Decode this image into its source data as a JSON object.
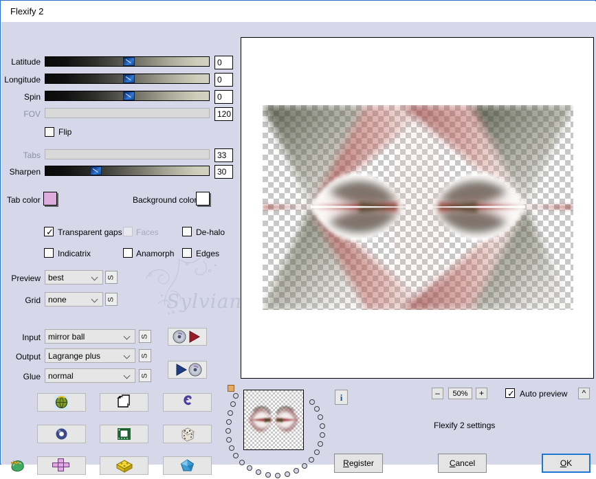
{
  "window": {
    "title": "Flexify 2"
  },
  "sliders": [
    {
      "label": "Latitude",
      "value": "0",
      "pct": 50,
      "disabled": false
    },
    {
      "label": "Longitude",
      "value": "0",
      "pct": 50,
      "disabled": false
    },
    {
      "label": "Spin",
      "value": "0",
      "pct": 50,
      "disabled": false
    },
    {
      "label": "FOV",
      "value": "120",
      "pct": 0,
      "disabled": true
    },
    {
      "label": "Tabs",
      "value": "33",
      "pct": 0,
      "disabled": true
    },
    {
      "label": "Sharpen",
      "value": "30",
      "pct": 30,
      "disabled": false
    }
  ],
  "flip": {
    "label": "Flip",
    "checked": false
  },
  "colors": {
    "tab_label": "Tab color",
    "tab_value": "#dcacdc",
    "background_label": "Background color",
    "background_value": "#ffffff"
  },
  "options": [
    {
      "label": "Transparent gaps",
      "checked": true,
      "disabled": false
    },
    {
      "label": "Faces",
      "checked": false,
      "disabled": true
    },
    {
      "label": "De-halo",
      "checked": false,
      "disabled": false
    },
    {
      "label": "Indicatrix",
      "checked": false,
      "disabled": false
    },
    {
      "label": "Anamorph",
      "checked": false,
      "disabled": false
    },
    {
      "label": "Edges",
      "checked": false,
      "disabled": false
    }
  ],
  "selects": [
    {
      "label": "Preview",
      "value": "best",
      "side_button": "S"
    },
    {
      "label": "Grid",
      "value": "none",
      "side_button": "S"
    },
    {
      "label": "Input",
      "value": "mirror ball",
      "side_button": "S"
    },
    {
      "label": "Output",
      "value": "Lagrange plus",
      "side_button": "S"
    },
    {
      "label": "Glue",
      "value": "normal",
      "side_button": "S"
    }
  ],
  "media_buttons": [
    {
      "name": "load-settings-button",
      "icons": "disc-icon, play-right-icon"
    },
    {
      "name": "save-settings-button",
      "icons": "play-right-icon, disc-icon"
    }
  ],
  "grid_buttons": [
    {
      "name": "globe-button",
      "icon": "globe-icon"
    },
    {
      "name": "pages-button",
      "icon": "pages-icon"
    },
    {
      "name": "undo-button",
      "icon": "undo-arrow-icon"
    },
    {
      "name": "sphere-button",
      "icon": "ring-icon"
    },
    {
      "name": "chip-button",
      "icon": "chip-icon"
    },
    {
      "name": "dice-button",
      "icon": "dice-icon"
    },
    {
      "name": "cross-button",
      "icon": "cross-layout-icon"
    },
    {
      "name": "cube-button",
      "icon": "yellow-cube-icon"
    },
    {
      "name": "gem-button",
      "icon": "blue-gem-icon"
    }
  ],
  "leaf_icon": {
    "name": "leaf-hand-icon"
  },
  "zoom": {
    "minus": "–",
    "value": "50%",
    "plus": "+"
  },
  "auto_preview": {
    "label": "Auto preview",
    "checked": true,
    "collapse": "^"
  },
  "status": {
    "text": "Flexify 2 settings"
  },
  "buttons": {
    "info": "i",
    "register_pre": "R",
    "register_post": "egister",
    "cancel_pre": "C",
    "cancel_post": "ancel",
    "ok_pre": "O",
    "ok_post": "K"
  },
  "watermark": {
    "text": "Sylviane"
  }
}
